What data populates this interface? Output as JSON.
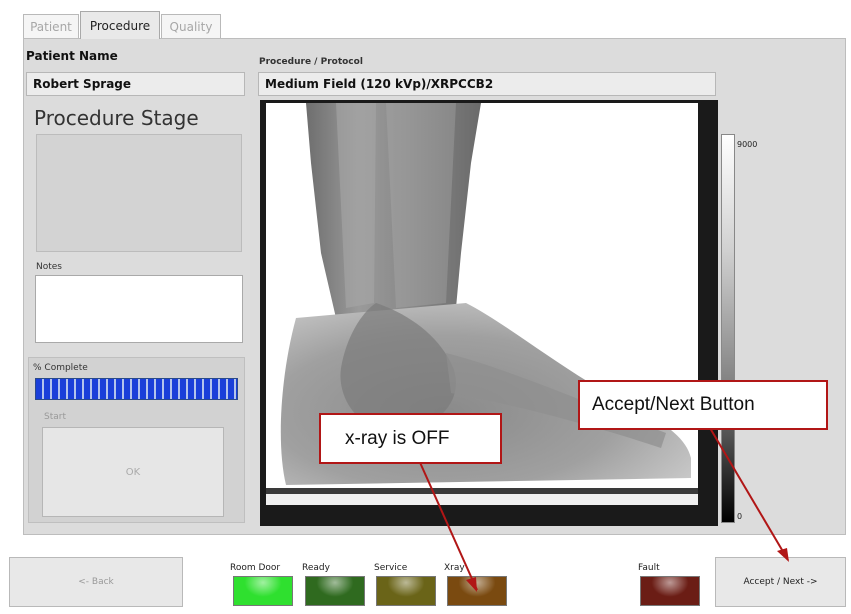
{
  "tabs": [
    {
      "label": "Patient",
      "state": "inactive"
    },
    {
      "label": "Procedure",
      "state": "active"
    },
    {
      "label": "Quality",
      "state": "inactive"
    }
  ],
  "patient": {
    "label": "Patient Name",
    "value": "Robert Sprage"
  },
  "procedure": {
    "label": "Procedure / Protocol",
    "value": "Medium Field (120 kVp)/XRPCCB2"
  },
  "stage": {
    "title": "Procedure Stage",
    "notes_label": "Notes"
  },
  "progress": {
    "label": "% Complete",
    "percent": 100,
    "start_label": "Start",
    "ok_label": "OK"
  },
  "colorbar": {
    "max_label": "9000",
    "min_label": "0"
  },
  "bottom": {
    "back_label": "<- Back",
    "accept_label": "Accept / Next ->",
    "indicators": [
      {
        "label": "Room Door",
        "color": "#2fe02f"
      },
      {
        "label": "Ready",
        "color": "#2f6a1f"
      },
      {
        "label": "Service",
        "color": "#6a6418"
      },
      {
        "label": "Xray",
        "color": "#7a4a10"
      },
      {
        "label": "Fault",
        "color": "#6b1d15"
      }
    ]
  },
  "callouts": {
    "accept": "Accept/Next Button",
    "xray": "x-ray is OFF"
  },
  "colors": {
    "callout_border": "#b11616",
    "progress_fill": "#1a3fd9"
  }
}
